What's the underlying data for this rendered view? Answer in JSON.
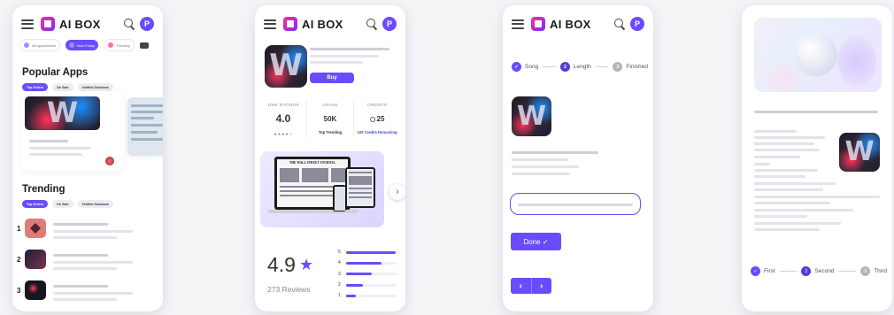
{
  "app": {
    "brand": "AI BOX",
    "avatar_initial": "P"
  },
  "colors": {
    "accent": "#6a4bff",
    "accent_dark": "#4e3fd8",
    "muted_step": "#b5b5c0"
  },
  "home": {
    "categories": [
      "All Applications",
      "New Friday",
      "Trending"
    ],
    "popular_title": "Popular Apps",
    "filter_pills": [
      "Top Sellers",
      "On Sale",
      "Verified Solutions"
    ],
    "trending_title": "Trending",
    "trending_items": [
      {
        "rank": "1"
      },
      {
        "rank": "2"
      },
      {
        "rank": "3"
      }
    ]
  },
  "detail": {
    "buy_label": "Buy",
    "stats": [
      {
        "label": "100K RATINGS",
        "value": "4.0",
        "sub": "★★★★☆"
      },
      {
        "label": "USAGE",
        "value": "50K",
        "sub": "Top Trending"
      },
      {
        "label": "CREDITS",
        "value": "25",
        "sub": "100 Credits Remaining"
      }
    ],
    "promo_title": "THE WALL STREET JOURNAL",
    "next_arrow": "›",
    "rating": "4.9",
    "reviews": "273 Reviews",
    "breakdown": [
      {
        "stars": "5",
        "fraction": 0.98
      },
      {
        "stars": "4",
        "fraction": 0.7
      },
      {
        "stars": "3",
        "fraction": 0.5
      },
      {
        "stars": "2",
        "fraction": 0.33
      },
      {
        "stars": "1",
        "fraction": 0.2
      }
    ]
  },
  "wizard": {
    "steps": [
      {
        "label": "Song",
        "marker": "✓",
        "state": "done"
      },
      {
        "label": "Length",
        "marker": "2",
        "state": "active"
      },
      {
        "label": "Finished",
        "marker": "3",
        "state": "off"
      }
    ],
    "done_label": "Done ✓",
    "prev_arrow": "‹",
    "next_arrow": "›"
  },
  "article": {
    "steps": [
      {
        "label": "First",
        "marker": "✓",
        "state": "done"
      },
      {
        "label": "Second",
        "marker": "2",
        "state": "active"
      },
      {
        "label": "Third",
        "marker": "3",
        "state": "off"
      }
    ]
  }
}
